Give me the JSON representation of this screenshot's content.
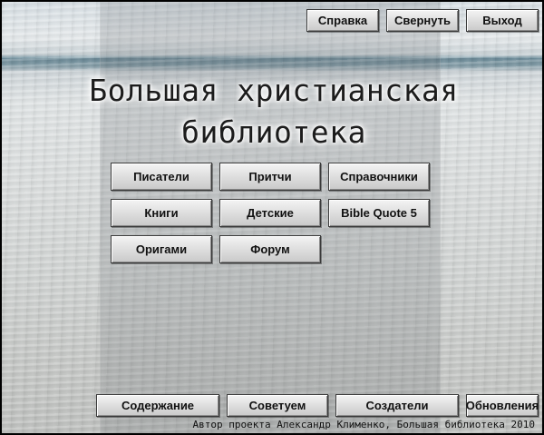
{
  "top_bar": {
    "help_label": "Справка",
    "minimize_label": "Свернуть",
    "exit_label": "Выход"
  },
  "title": {
    "line1": "Большая христианская",
    "line2": "библиотека"
  },
  "menu": {
    "writers": "Писатели",
    "parables": "Притчи",
    "references": "Справочники",
    "books": "Книги",
    "kids": "Детские",
    "bible_quote": "Bible Quote 5",
    "origami": "Оригами",
    "forum": "Форум"
  },
  "bottom_bar": {
    "contents_label": "Содержание",
    "recommend_label": "Советуем",
    "creators_label": "Создатели",
    "updates_label": "Обновления"
  },
  "footer": {
    "credit": "Автор проекта Александр Клименко, Большая библиотека 2010"
  }
}
